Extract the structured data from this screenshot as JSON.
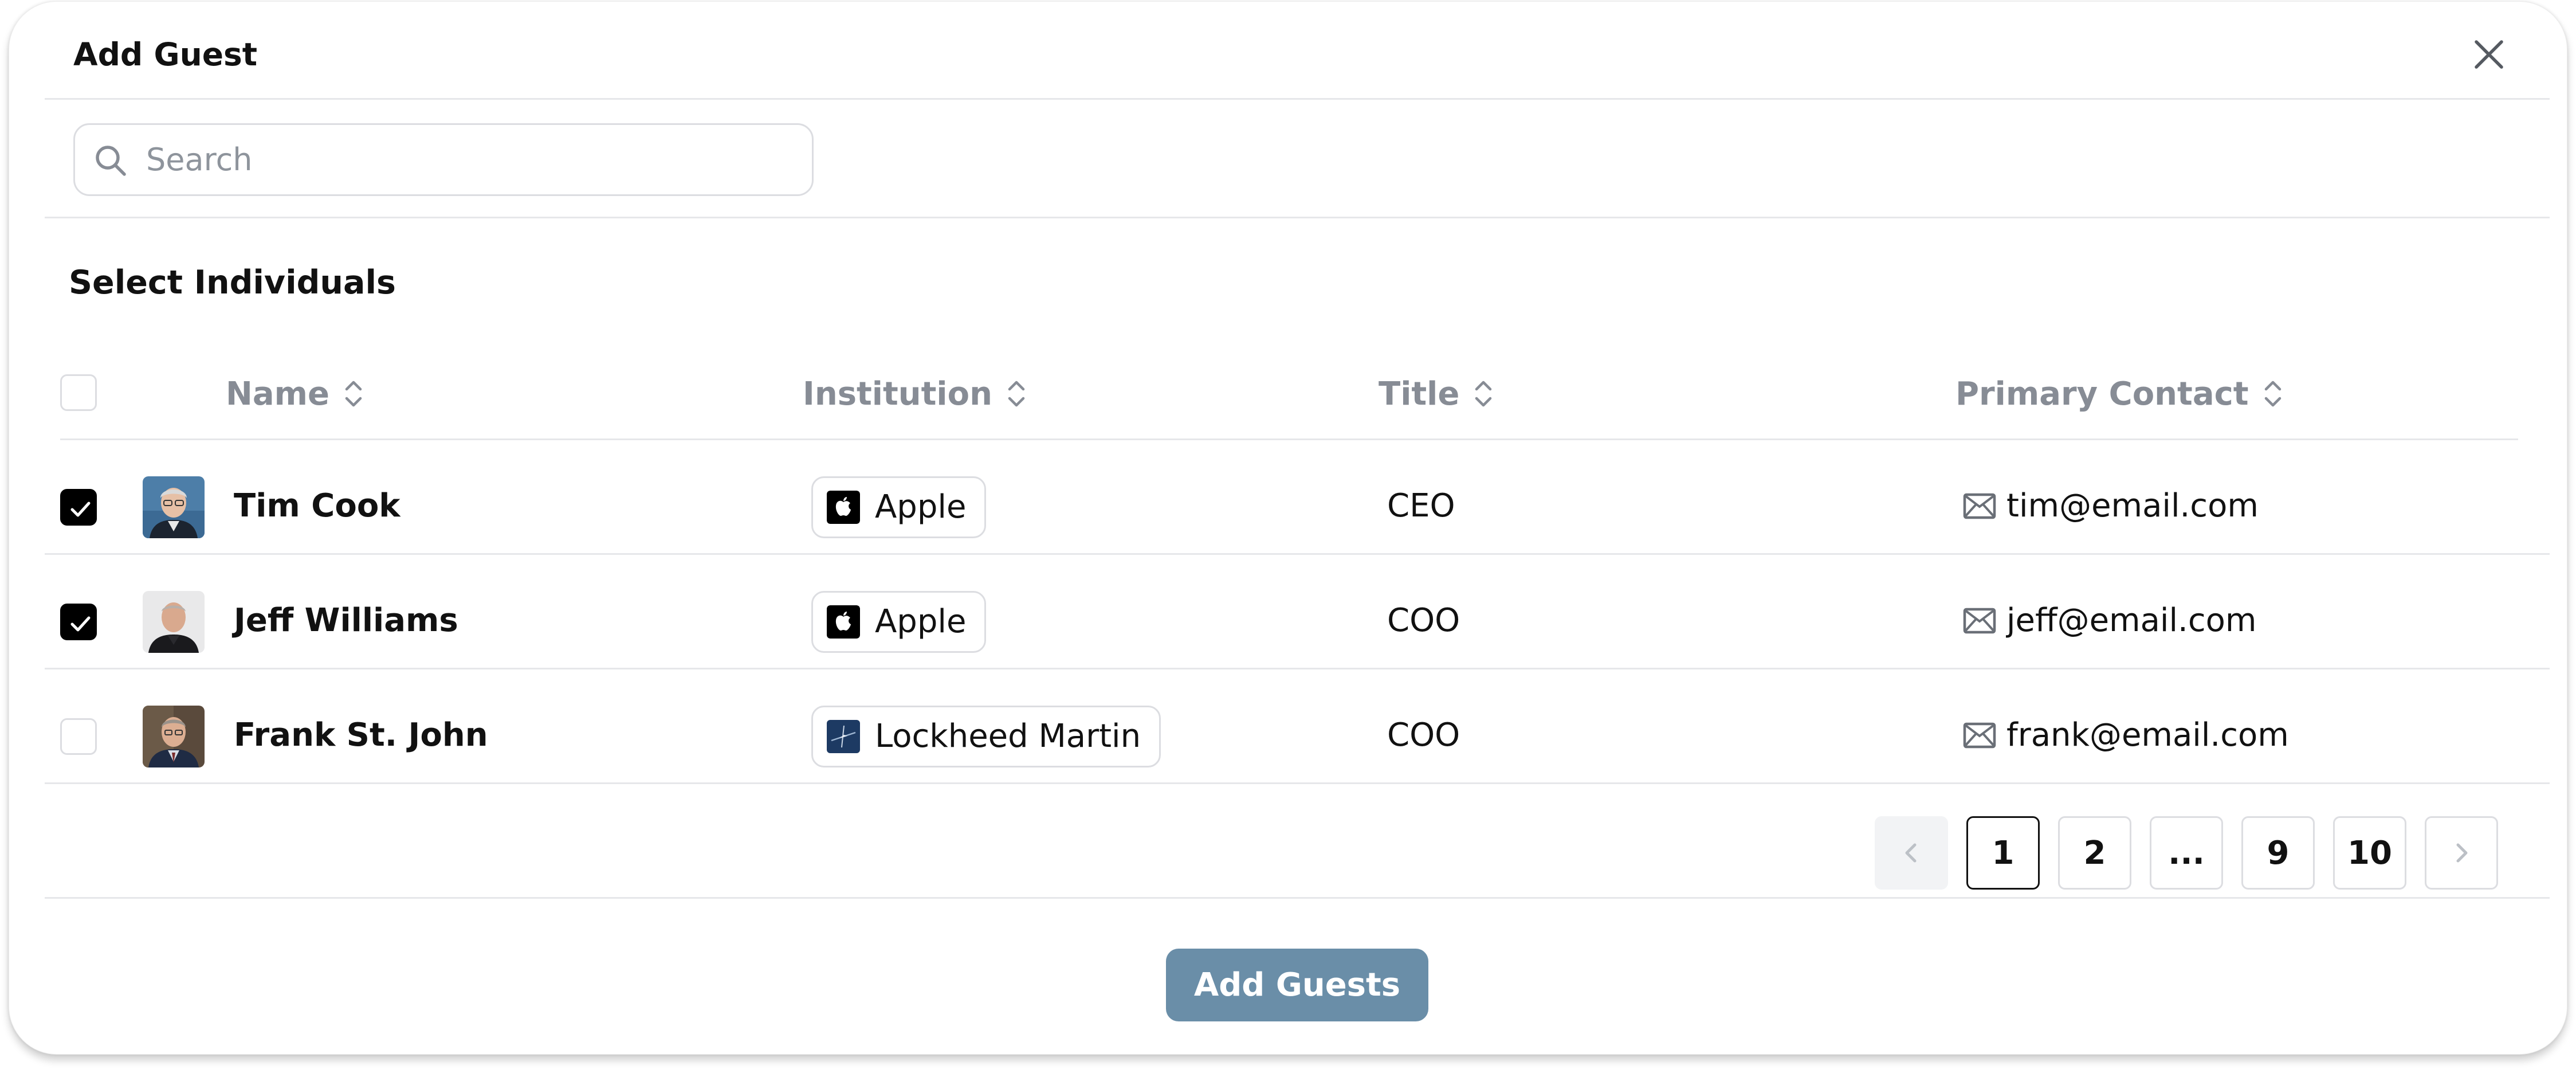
{
  "dialog": {
    "title": "Add Guest",
    "close_icon": "close-icon"
  },
  "search": {
    "placeholder": "Search",
    "value": "",
    "icon": "search-icon"
  },
  "section": {
    "title": "Select Individuals"
  },
  "table": {
    "select_all_checked": false,
    "columns": [
      {
        "label": "Name",
        "sortable": true
      },
      {
        "label": "Institution",
        "sortable": true
      },
      {
        "label": "Title",
        "sortable": true
      },
      {
        "label": "Primary Contact",
        "sortable": true
      }
    ],
    "rows": [
      {
        "checked": true,
        "name": "Tim Cook",
        "institution": "Apple",
        "institution_logo": "apple-logo-icon",
        "title": "CEO",
        "contact": "tim@email.com"
      },
      {
        "checked": true,
        "name": "Jeff Williams",
        "institution": "Apple",
        "institution_logo": "apple-logo-icon",
        "title": "COO",
        "contact": "jeff@email.com"
      },
      {
        "checked": false,
        "name": "Frank St. John",
        "institution": "Lockheed Martin",
        "institution_logo": "lockheed-martin-logo-icon",
        "title": "COO",
        "contact": "frank@email.com"
      }
    ]
  },
  "pagination": {
    "prev_icon": "chevron-left-icon",
    "next_icon": "chevron-right-icon",
    "pages": [
      "1",
      "2",
      "...",
      "9",
      "10"
    ],
    "current": "1"
  },
  "footer": {
    "submit_label": "Add Guests"
  },
  "colors": {
    "primary_button": "#6a8ea8",
    "muted_text": "#878c95",
    "border": "#dcdde1",
    "lockheed_logo": "#1d3a63"
  }
}
